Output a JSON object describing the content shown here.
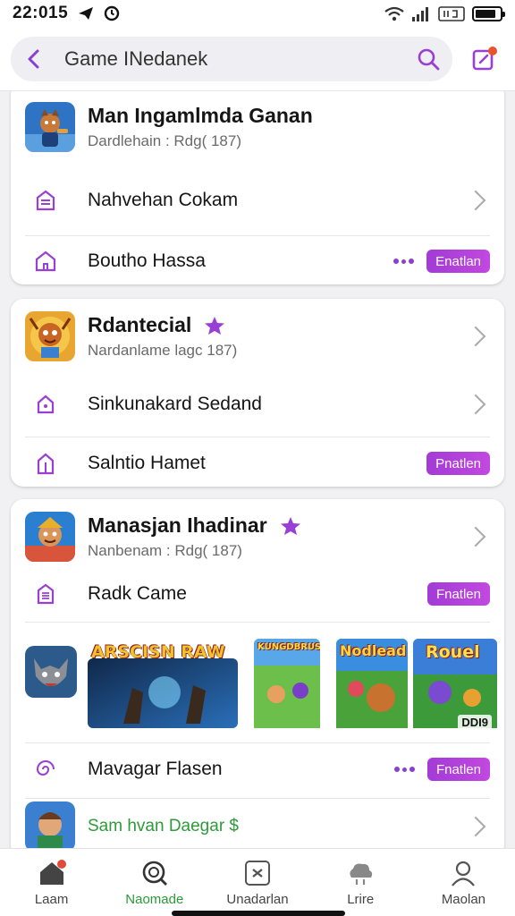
{
  "status": {
    "time": "22:015"
  },
  "search": {
    "text": "Game INedanek"
  },
  "colors": {
    "accent": "#a33bd6",
    "accent_light": "#c248e0",
    "nav_active": "#2a9a3a",
    "subtitle_green": "#2f9a3a"
  },
  "cards": [
    {
      "title": "Man Ingamlmda Ganan",
      "subtitle": "Dardlehain : Rdg( 187)",
      "rows": [
        {
          "label": "Nahvehan Cokam",
          "icon": "building-icon",
          "trailing": "chevron"
        },
        {
          "label": "Boutho Hassa",
          "icon": "house-icon",
          "trailing": "badge",
          "badge": "Enatlan",
          "dots": true
        }
      ]
    },
    {
      "title": "Rdantecial",
      "subtitle": "Nardanlame lagc 187)",
      "rows": [
        {
          "label": "Sinkunakard Sedand",
          "icon": "house-icon",
          "trailing": "chevron"
        },
        {
          "label": "Salntio Hamet",
          "icon": "house-icon",
          "trailing": "badge",
          "badge": "Pnatlen"
        }
      ]
    },
    {
      "title": "Manasjan Ihadinar",
      "subtitle": "Nanbenam : Rdg( 187)",
      "rows": [
        {
          "label": "Radk Came",
          "icon": "document-icon",
          "trailing": "badge",
          "badge": "Fnatlen"
        },
        {
          "label": "Mavagar Flasen",
          "icon": "spiral-icon",
          "trailing": "badge",
          "badge": "Fnatlen",
          "dots": true
        }
      ],
      "banners": [
        {
          "title": "ARSCISN RAW"
        },
        {
          "title": "KUNGDBRUS"
        },
        {
          "title": "Nodlead"
        },
        {
          "title": "Rouel",
          "badge": "DDI9"
        }
      ]
    }
  ],
  "last_item": {
    "title": "Sam hvan Daegar $"
  },
  "bottom_nav": [
    {
      "label": "Laam",
      "icon": "home-icon"
    },
    {
      "label": "Naomade",
      "icon": "search-icon",
      "active": true
    },
    {
      "label": "Unadarlan",
      "icon": "gamepad-icon"
    },
    {
      "label": "Lrire",
      "icon": "cloud-icon"
    },
    {
      "label": "Maolan",
      "icon": "profile-icon"
    }
  ]
}
